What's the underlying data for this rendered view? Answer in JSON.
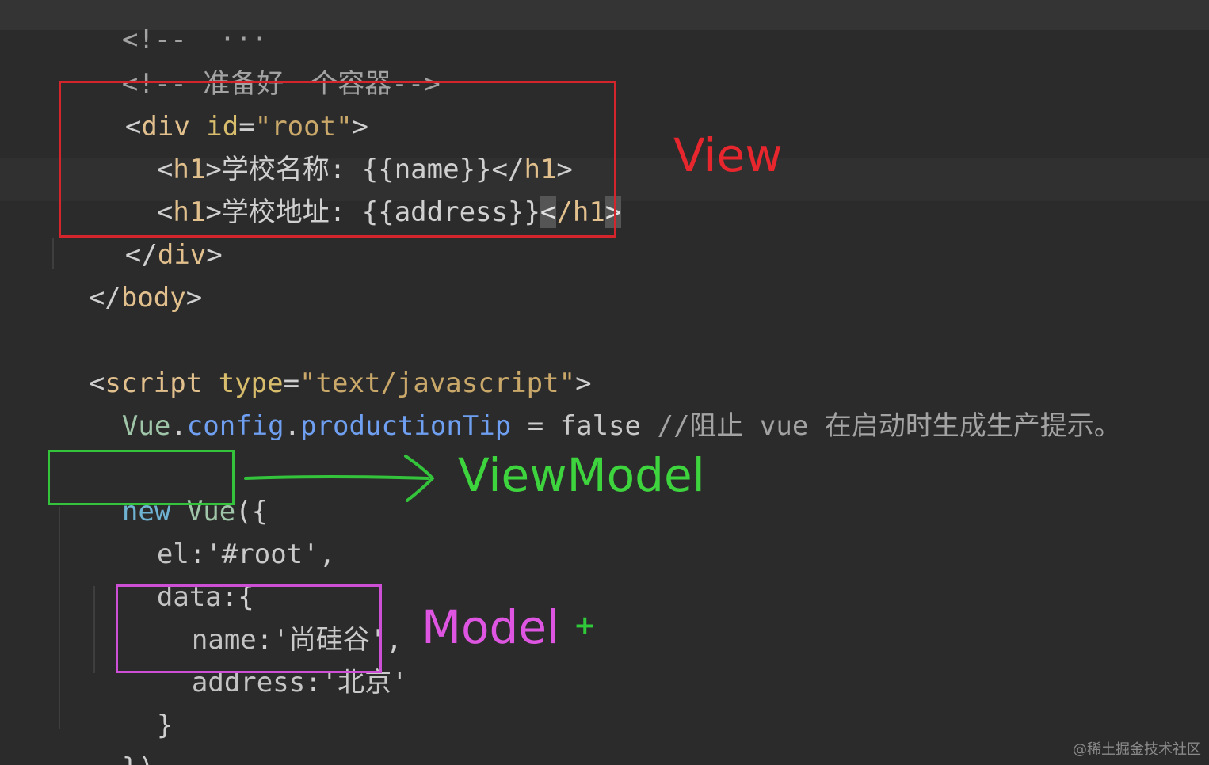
{
  "code": {
    "line0": {
      "open": "<!--",
      "rest": "  ···"
    },
    "line1": {
      "open": "<!--",
      "text": " 准备好一个容器",
      "close": "-->"
    },
    "line2": {
      "lt": "<",
      "tag": "div",
      "sp": " ",
      "attr": "id",
      "eq": "=",
      "val": "\"root\"",
      "gt": ">"
    },
    "line3": {
      "open": "<",
      "tag": "h1",
      "gt": ">",
      "text": "学校名称: {{name}}",
      "closeopen": "</",
      "closetag": "h1",
      "closegt": ">"
    },
    "line4": {
      "open": "<",
      "tag": "h1",
      "gt": ">",
      "text": "学校地址: {{address}}",
      "cursor1": "<",
      "closemid": "/h1",
      "cursor2": ">"
    },
    "line5": {
      "open": "</",
      "tag": "div",
      "gt": ">"
    },
    "line6": {
      "open": "</",
      "tag": "body",
      "gt": ">"
    },
    "line8": {
      "lt": "<",
      "tag": "script",
      "sp": " ",
      "attr": "type",
      "eq": "=",
      "val": "\"text/javascript\"",
      "gt": ">"
    },
    "line9": {
      "obj": "Vue",
      "dot1": ".",
      "p1": "config",
      "dot2": ".",
      "p2": "productionTip",
      "op": " = ",
      "bool": "false",
      "comment": " //阻止 vue 在启动时生成生产提示。"
    },
    "line10": {
      "kw": "new",
      "sp": " ",
      "cls": "Vue",
      "rest": "({"
    },
    "line11": {
      "key": "el",
      "colon": ":",
      "val": "'#root'",
      "comma": ","
    },
    "line12": {
      "key": "data",
      "rest": ":{"
    },
    "line13": {
      "key": "name",
      "colon": ":",
      "val": "'尚硅谷'",
      "comma": ","
    },
    "line14": {
      "key": "address",
      "colon": ":",
      "val": "'北京'"
    },
    "line15": {
      "text": "}"
    },
    "line16": {
      "text": "})"
    }
  },
  "annotations": {
    "view": "View",
    "viewmodel": "ViewModel",
    "model": "Model",
    "plus": "+"
  },
  "colors": {
    "view": "#e8262e",
    "viewmodel": "#3ed43e",
    "model": "#dd55e0"
  },
  "watermark": "@稀土掘金技术社区"
}
